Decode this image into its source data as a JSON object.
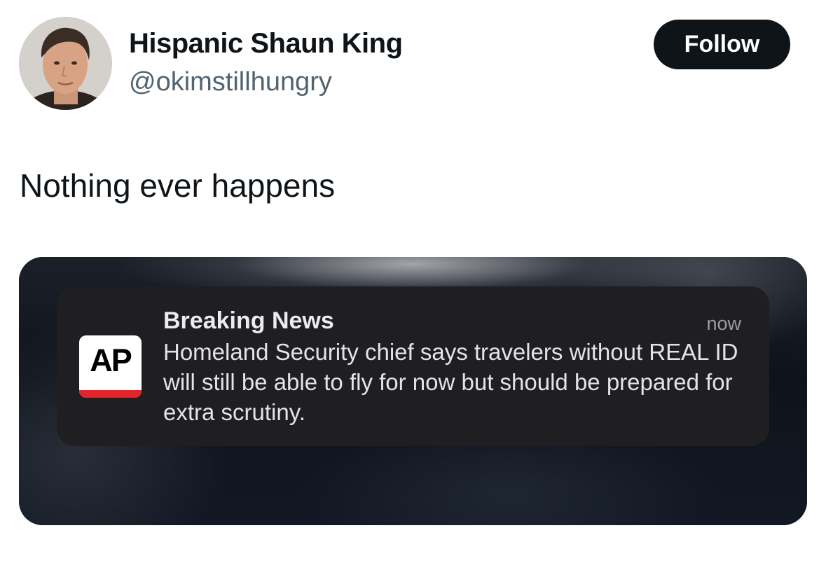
{
  "user": {
    "display_name": "Hispanic Shaun King",
    "handle": "@okimstillhungry",
    "avatar_icon": "profile-photo"
  },
  "follow_button": {
    "label": "Follow"
  },
  "tweet": {
    "text": "Nothing ever happens"
  },
  "notification": {
    "app_icon": "ap-logo",
    "app_icon_text": "AP",
    "title": "Breaking News",
    "time": "now",
    "body": "Homeland Security chief says travelers without REAL ID will still be able to fly for now but should be prepared for extra scrutiny."
  },
  "colors": {
    "follow_bg": "#0f1419",
    "handle_text": "#536471",
    "ap_red": "#e0262c",
    "notification_bg": "#1f1f21"
  }
}
